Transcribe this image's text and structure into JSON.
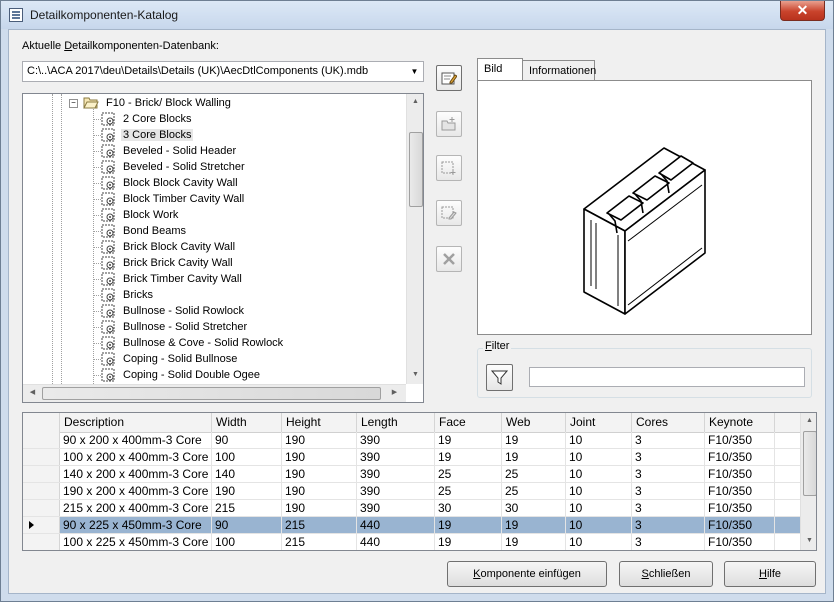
{
  "window": {
    "title": "Detailkomponenten-Katalog",
    "close_glyph": "✕"
  },
  "database": {
    "label": "Aktuelle Detailkomponenten-Datenbank:",
    "path": "C:\\..\\ACA 2017\\deu\\Details\\Details (UK)\\AecDtlComponents (UK).mdb"
  },
  "tree": {
    "parent": "F10 - Brick/ Block Walling",
    "items": [
      "2 Core Blocks",
      "3 Core Blocks",
      "Beveled - Solid Header",
      "Beveled - Solid Stretcher",
      "Block Block Cavity Wall",
      "Block Timber Cavity Wall",
      "Block Work",
      "Bond Beams",
      "Brick Block Cavity Wall",
      "Brick Brick Cavity Wall",
      "Brick Timber Cavity Wall",
      "Bricks",
      "Bullnose - Solid Rowlock",
      "Bullnose - Solid Stretcher",
      "Bullnose & Cove - Solid Rowlock",
      "Coping - Solid Bullnose",
      "Coping - Solid Double Ogee"
    ],
    "selected": "3 Core Blocks"
  },
  "toolbar": {
    "icons": [
      "edit-icon",
      "folder-new-icon",
      "add-component-icon",
      "edit-component-icon",
      "delete-icon"
    ]
  },
  "tabs": [
    {
      "label": "Bild",
      "active": true
    },
    {
      "label": "Informationen",
      "active": false
    }
  ],
  "filter": {
    "legend": "Filter",
    "value": ""
  },
  "table": {
    "columns": [
      "Description",
      "Width",
      "Height",
      "Length",
      "Face",
      "Web",
      "Joint",
      "Cores",
      "Keynote"
    ],
    "rows": [
      [
        "90 x 200 x 400mm-3 Core",
        "90",
        "190",
        "390",
        "19",
        "19",
        "10",
        "3",
        "F10/350"
      ],
      [
        "100 x 200 x 400mm-3 Core",
        "100",
        "190",
        "390",
        "19",
        "19",
        "10",
        "3",
        "F10/350"
      ],
      [
        "140 x 200 x 400mm-3 Core",
        "140",
        "190",
        "390",
        "25",
        "25",
        "10",
        "3",
        "F10/350"
      ],
      [
        "190 x 200 x 400mm-3 Core",
        "190",
        "190",
        "390",
        "25",
        "25",
        "10",
        "3",
        "F10/350"
      ],
      [
        "215 x 200 x 400mm-3 Core",
        "215",
        "190",
        "390",
        "30",
        "30",
        "10",
        "3",
        "F10/350"
      ],
      [
        "90 x 225 x 450mm-3 Core",
        "90",
        "215",
        "440",
        "19",
        "19",
        "10",
        "3",
        "F10/350"
      ],
      [
        "100 x 225 x 450mm-3 Core",
        "100",
        "215",
        "440",
        "19",
        "19",
        "10",
        "3",
        "F10/350"
      ]
    ],
    "selected_row": 5
  },
  "buttons": {
    "insert": "Komponente einfügen",
    "close": "Schließen",
    "help": "Hilfe"
  },
  "colors": {
    "selection": "#99b4d1",
    "close_button": "#c9432c"
  }
}
